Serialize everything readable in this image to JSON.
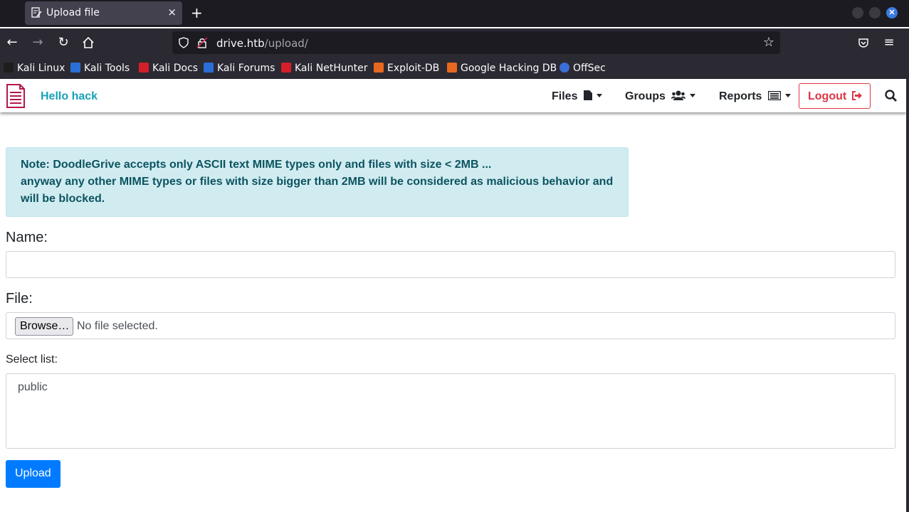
{
  "browser": {
    "tab_title": "Upload file",
    "tab_close": "×",
    "new_tab": "+",
    "window_close": "✕",
    "url_host": "drive.htb",
    "url_path": "/upload/",
    "bookmarks": [
      {
        "label": "Kali Linux",
        "color": "#1e1e1e"
      },
      {
        "label": "Kali Tools",
        "color": "#2a6fd6"
      },
      {
        "label": "Kali Docs",
        "color": "#d41f2b"
      },
      {
        "label": "Kali Forums",
        "color": "#2a6fd6"
      },
      {
        "label": "Kali NetHunter",
        "color": "#d41f2b"
      },
      {
        "label": "Exploit-DB",
        "color": "#e8681f"
      },
      {
        "label": "Google Hacking DB",
        "color": "#e8681f"
      },
      {
        "label": "OffSec",
        "color": "#3b6fd6"
      }
    ]
  },
  "site": {
    "greeting": "Hello hack",
    "menu": {
      "files": "Files",
      "groups": "Groups",
      "reports": "Reports",
      "logout": "Logout"
    },
    "colors": {
      "accent": "#17a2b8",
      "danger": "#dc3545",
      "primary": "#007bff",
      "logo": "#b5164b"
    }
  },
  "alert": {
    "line1": "Note: DoodleGrive accepts only ASCII text MIME types only and files with size < 2MB ...",
    "line2": "anyway any other MIME types or files with size bigger than 2MB will be considered as malicious behavior and will be blocked."
  },
  "form": {
    "name_label": "Name:",
    "name_value": "",
    "file_label": "File:",
    "browse_label": "Browse…",
    "no_file_text": "No file selected.",
    "select_label": "Select list:",
    "options": [
      "public"
    ],
    "submit_label": "Upload"
  }
}
